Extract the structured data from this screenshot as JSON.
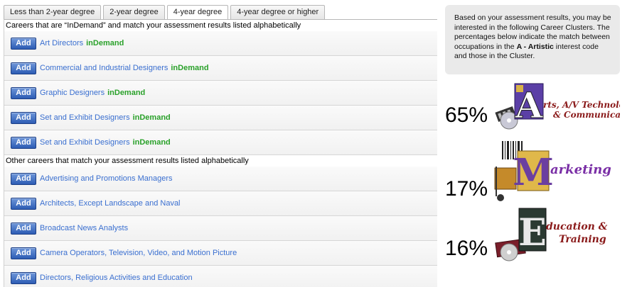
{
  "tabs": [
    "Less than 2-year degree",
    "2-year degree",
    "4-year degree",
    "4-year degree or higher"
  ],
  "add_label": "Add",
  "indemand_label": "inDemand",
  "indemand_heading": "Careers that are “InDemand” and match your assessment results listed alphabetically",
  "other_heading": "Other careers that match your assessment results listed alphabetically",
  "indemand_careers": [
    "Art Directors",
    "Commercial and Industrial Designers",
    "Graphic Designers",
    "Set and Exhibit Designers",
    "Set and Exhibit Designers"
  ],
  "other_careers": [
    "Advertising and Promotions Managers",
    "Architects, Except Landscape and Naval",
    "Broadcast News Analysts",
    "Camera Operators, Television, Video, and Motion Picture",
    "Directors, Religious Activities and Education"
  ],
  "info": {
    "text_1": "Based on your assessment results, you may be interested in the following Career Clusters. The percentages below indicate the match between occupations in the ",
    "code": "A - Artistic",
    "text_2": " interest code and those in the Cluster."
  },
  "clusters": [
    {
      "percent": "65%",
      "letter": "A",
      "name_line1": "rts, A/V Technology",
      "name_line2": "& Communications"
    },
    {
      "percent": "17%",
      "letter": "M",
      "name_line1": "arketing",
      "name_line2": ""
    },
    {
      "percent": "16%",
      "letter": "E",
      "name_line1": "ducation &",
      "name_line2": "Training"
    }
  ]
}
